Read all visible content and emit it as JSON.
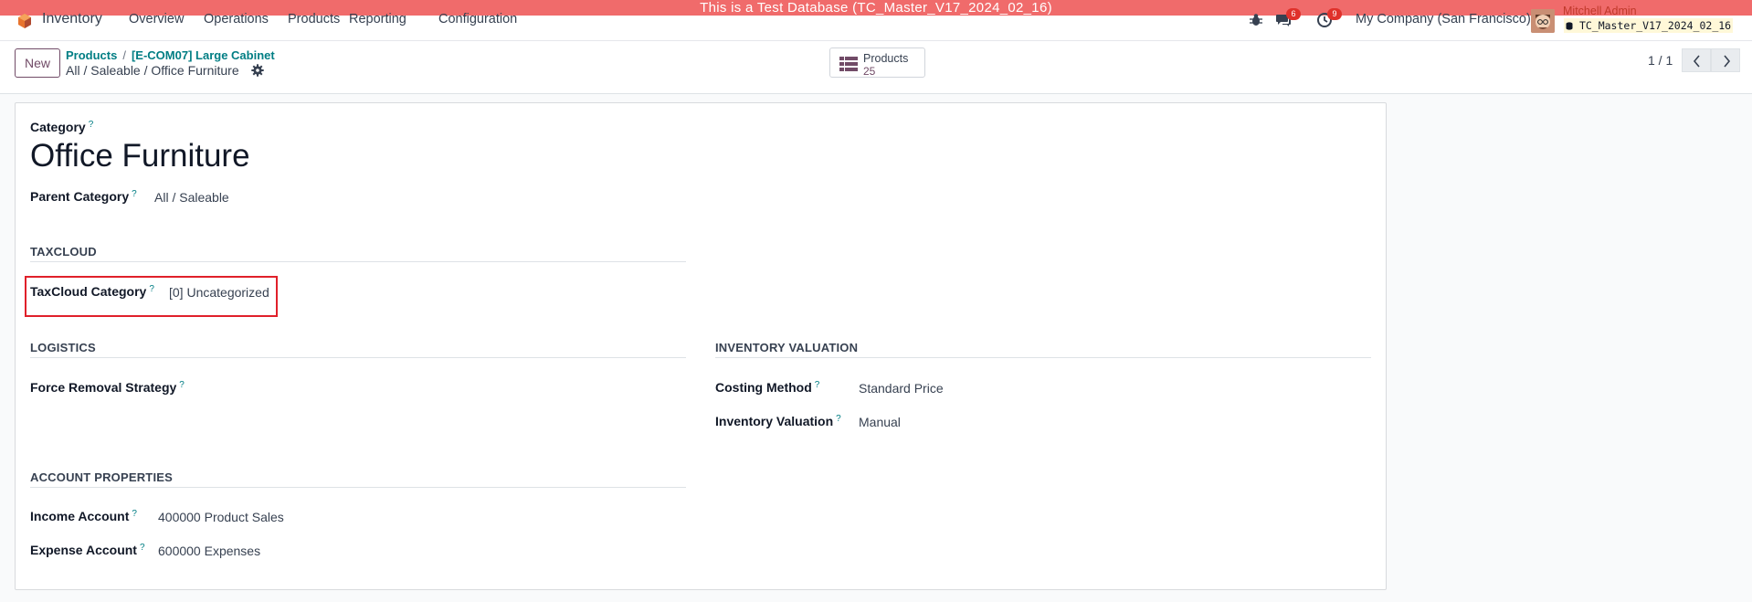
{
  "banner": "This is a Test Database (TC_Master_V17_2024_02_16)",
  "app": {
    "name": "Inventory"
  },
  "menu": [
    "Overview",
    "Operations",
    "Products",
    "Reporting",
    "Configuration"
  ],
  "systray": {
    "messages_badge": "6",
    "activities_badge": "9",
    "company": "My Company (San Francisco)",
    "user": "Mitchell Admin",
    "database": "TC_Master_V17_2024_02_16"
  },
  "control": {
    "new_label": "New",
    "breadcrumb": [
      "Products",
      "[E-COM07] Large Cabinet"
    ],
    "breadcrumb_sep": "/",
    "current": "All / Saleable / Office Furniture",
    "smart_button": {
      "label": "Products",
      "count": "25"
    },
    "pager": "1 / 1"
  },
  "form": {
    "category_label": "Category",
    "category_name": "Office Furniture",
    "parent_label": "Parent Category",
    "parent_value": "All / Saleable",
    "help": "?",
    "taxcloud": {
      "title": "TAXCLOUD",
      "field_label": "TaxCloud Category",
      "field_value": "[0] Uncategorized"
    },
    "logistics": {
      "title": "LOGISTICS",
      "removal_label": "Force Removal Strategy",
      "removal_value": ""
    },
    "valuation": {
      "title": "INVENTORY VALUATION",
      "costing_label": "Costing Method",
      "costing_value": "Standard Price",
      "valuation_label": "Inventory Valuation",
      "valuation_value": "Manual"
    },
    "accounts": {
      "title": "ACCOUNT PROPERTIES",
      "income_label": "Income Account",
      "income_value": "400000 Product Sales",
      "expense_label": "Expense Account",
      "expense_value": "600000 Expenses"
    }
  },
  "colors": {
    "brand": "#714b67",
    "link": "#017e84",
    "banner": "#f06b6b",
    "highlight": "#e0202a"
  },
  "icons": [
    "app-logo-icon",
    "bug-icon",
    "chat-icon",
    "clock-icon",
    "gear-icon",
    "list-icon",
    "chevron-left-icon",
    "chevron-right-icon",
    "database-icon"
  ]
}
